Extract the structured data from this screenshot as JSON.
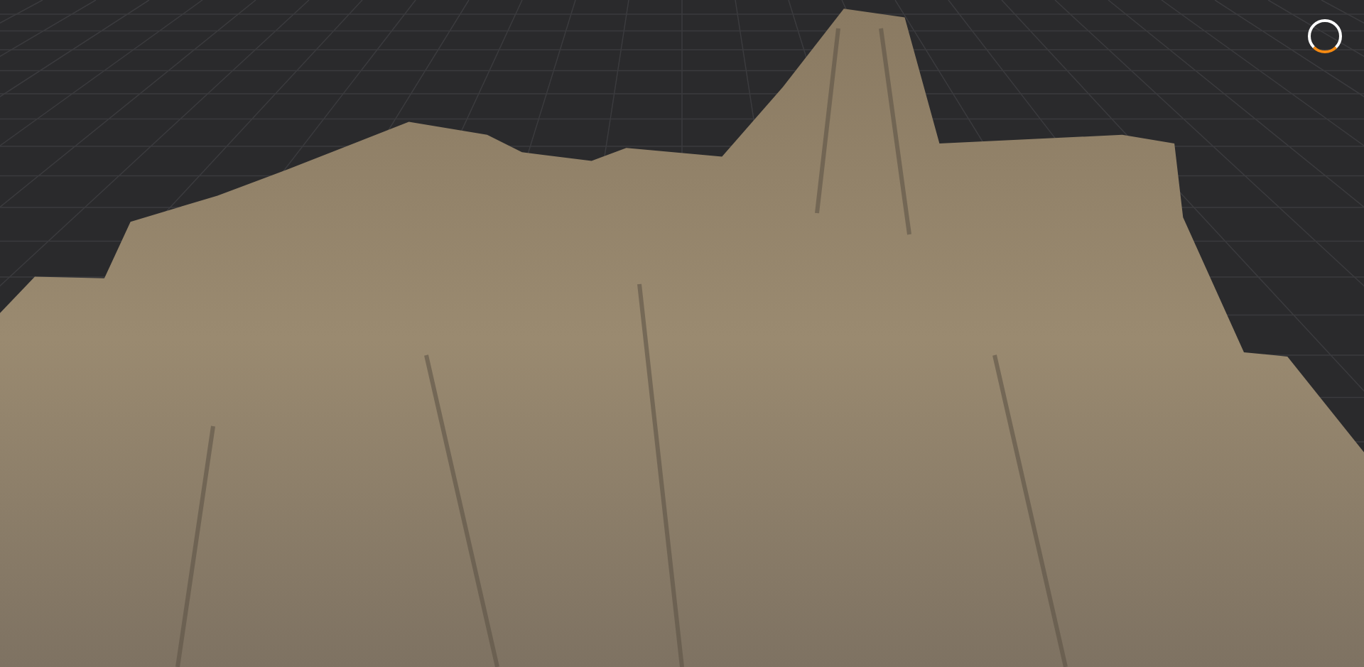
{
  "viewport": {
    "progress": {
      "level": 0.25
    }
  }
}
